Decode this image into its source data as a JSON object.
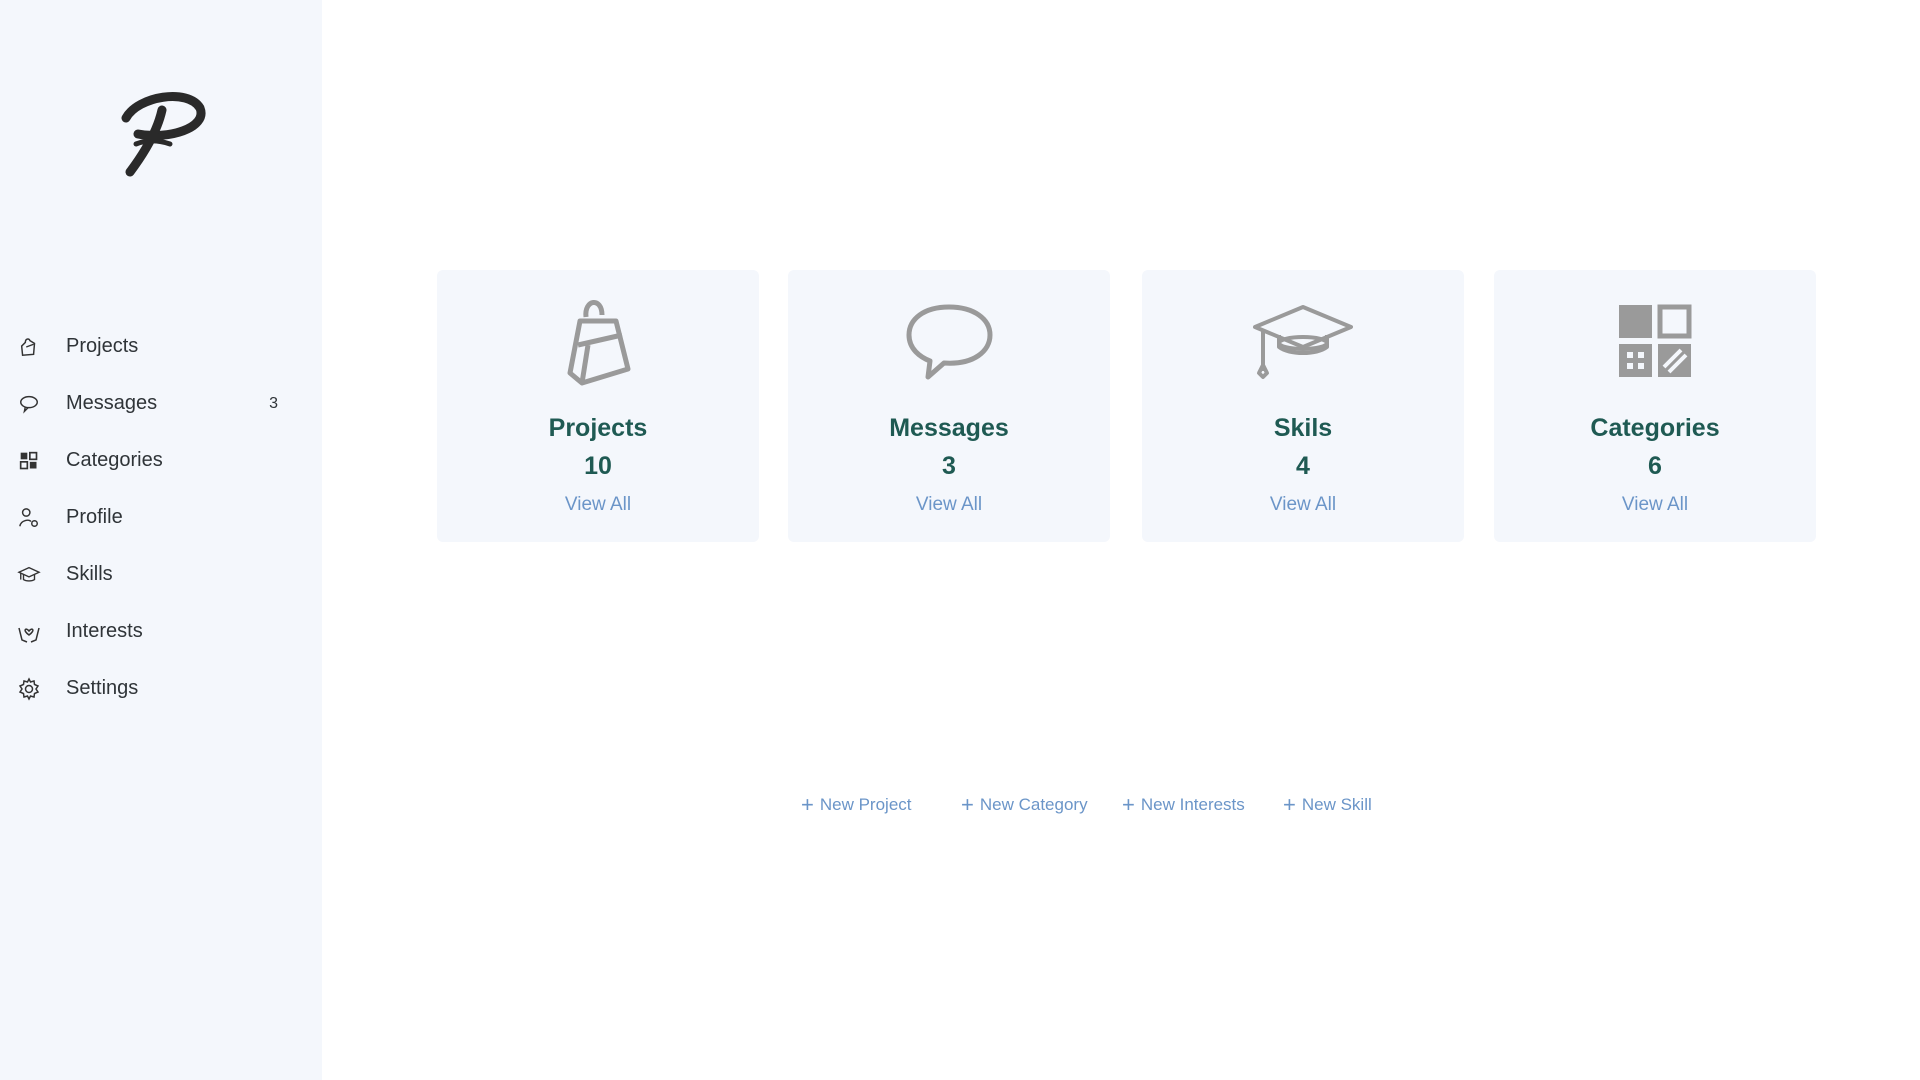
{
  "sidebar": {
    "logo_icon": "p-signature-logo",
    "items": [
      {
        "label": "Projects",
        "icon": "bag-icon",
        "count": ""
      },
      {
        "label": "Messages",
        "icon": "chat-bubble-icon",
        "count": "3"
      },
      {
        "label": "Categories",
        "icon": "grid-icon",
        "count": ""
      },
      {
        "label": "Profile",
        "icon": "user-gear-icon",
        "count": ""
      },
      {
        "label": "Skills",
        "icon": "graduation-cap-icon",
        "count": ""
      },
      {
        "label": "Interests",
        "icon": "hands-heart-icon",
        "count": ""
      },
      {
        "label": "Settings",
        "icon": "gear-icon",
        "count": ""
      }
    ]
  },
  "cards": [
    {
      "title": "Projects",
      "count": "10",
      "link": "View All",
      "icon": "bag-icon"
    },
    {
      "title": "Messages",
      "count": "3",
      "link": "View All",
      "icon": "chat-bubble-icon"
    },
    {
      "title": "Skils",
      "count": "4",
      "link": "View All",
      "icon": "graduation-cap-icon"
    },
    {
      "title": "Categories",
      "count": "6",
      "link": "View All",
      "icon": "grid-icon"
    }
  ],
  "actions": [
    {
      "label": "New Project"
    },
    {
      "label": "New Category"
    },
    {
      "label": "New Interests"
    },
    {
      "label": "New Skill"
    }
  ],
  "colors": {
    "sidebar_bg": "#f4f7fc",
    "card_bg": "#f4f7fc",
    "accent_text": "#1f5a53",
    "link": "#6b95c8",
    "icon_gray": "#9a9a9a"
  }
}
